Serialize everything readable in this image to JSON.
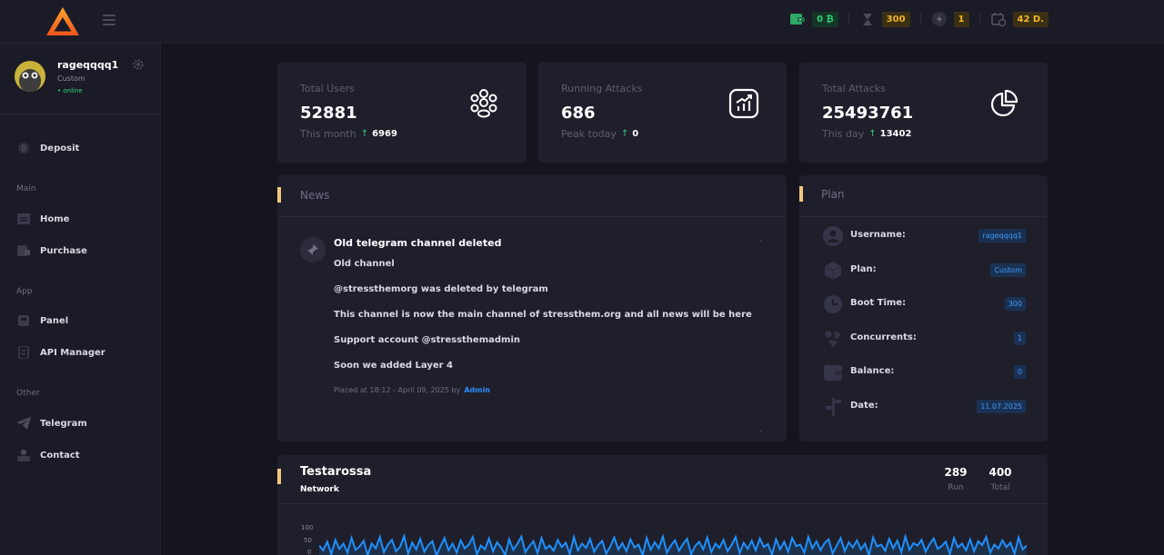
{
  "topbar": {
    "stats": [
      {
        "icon": "wallet-icon",
        "value": "0 ₿",
        "tone": "green"
      },
      {
        "icon": "hourglass-icon",
        "value": "300",
        "tone": "yellow"
      },
      {
        "icon": "lightning-icon",
        "value": "1",
        "tone": "yellow"
      },
      {
        "icon": "calendar-icon",
        "value": "42 D.",
        "tone": "yellow"
      }
    ]
  },
  "sidebar": {
    "profile": {
      "username": "rageqqqq1",
      "plan": "Custom",
      "status": "• online"
    },
    "deposit": "Deposit",
    "sections": [
      {
        "label": "Main",
        "items": [
          "Home",
          "Purchase"
        ]
      },
      {
        "label": "App",
        "items": [
          "Panel",
          "API Manager"
        ]
      },
      {
        "label": "Other",
        "items": [
          "Telegram",
          "Contact"
        ]
      }
    ]
  },
  "stat_cards": [
    {
      "title": "Total Users",
      "value": "52881",
      "sub_label": "This month",
      "sub_value": "6969",
      "icon": "users-icon"
    },
    {
      "title": "Running Attacks",
      "value": "686",
      "sub_label": "Peak today",
      "sub_value": "0",
      "icon": "chart-up-icon"
    },
    {
      "title": "Total Attacks",
      "value": "25493761",
      "sub_label": "This day",
      "sub_value": "13402",
      "icon": "pie-chart-icon"
    }
  ],
  "news": {
    "title": "News",
    "post": {
      "title": "Old telegram channel deleted",
      "lines": [
        "Old channel",
        "@stressthemorg was deleted by telegram",
        "This channel is now the main channel of stressthem.org and all news will be here",
        "Support account @stressthemadmin",
        "Soon we added Layer 4"
      ],
      "meta": "Placed at 18:12 - April 09, 2025 by",
      "author": "Admin"
    }
  },
  "plan": {
    "title": "Plan",
    "rows": [
      {
        "label": "Username:",
        "value": "rageqqqq1",
        "icon": "user-icon"
      },
      {
        "label": "Plan:",
        "value": "Custom",
        "icon": "cube-icon"
      },
      {
        "label": "Boot Time:",
        "value": "300",
        "icon": "clock-icon"
      },
      {
        "label": "Concurrents:",
        "value": "1",
        "icon": "concurrents-icon"
      },
      {
        "label": "Balance:",
        "value": "0",
        "icon": "wallet-icon"
      },
      {
        "label": "Date:",
        "value": "11.07.2025",
        "icon": "signpost-icon"
      }
    ]
  },
  "network": {
    "title": "Testarossa",
    "subtitle": "Network",
    "run_value": "289",
    "run_label": "Run",
    "total_value": "400",
    "total_label": "Total",
    "accent": "#1e90ff"
  },
  "chart_data": {
    "type": "line",
    "title": "Testarossa",
    "ylim": [
      0,
      100
    ],
    "yticks": [
      "100",
      "50",
      "0"
    ],
    "grid": false,
    "series": [
      {
        "values": [
          70,
          60,
          78,
          52,
          82,
          63,
          74,
          55,
          86,
          61,
          68,
          80,
          50,
          74,
          64,
          88,
          56,
          72,
          82,
          58,
          67,
          90,
          53,
          76,
          62,
          84,
          57,
          71,
          79,
          49,
          68,
          86,
          60,
          74,
          55,
          81,
          64,
          72,
          88,
          52,
          70,
          62,
          85,
          58,
          77,
          66,
          50,
          83,
          61,
          73,
          89,
          56,
          69,
          79,
          54,
          86,
          63,
          70,
          59,
          82,
          67,
          76,
          52,
          88,
          60,
          74,
          65,
          84,
          57,
          71,
          80,
          53,
          68,
          87,
          62,
          75,
          58,
          83,
          66,
          72,
          50,
          86,
          61,
          77,
          64,
          89,
          55,
          70,
          81,
          59,
          73,
          84,
          52,
          69,
          78,
          62,
          87,
          56,
          74,
          65,
          82,
          58,
          71,
          88,
          54,
          76,
          63,
          80,
          60,
          85,
          67,
          73,
          51,
          83,
          62,
          78,
          57,
          86,
          69,
          72,
          55,
          88,
          64,
          79,
          60,
          75,
          83,
          53,
          70,
          86,
          58,
          77,
          66,
          81,
          62,
          74,
          50,
          87,
          68,
          72,
          59,
          84,
          64,
          80,
          56,
          89,
          61,
          75,
          70,
          82,
          57,
          73,
          85,
          63,
          69,
          78,
          52,
          86,
          66,
          74,
          60,
          83,
          58,
          79,
          71,
          88,
          55,
          72,
          64,
          81,
          67,
          76,
          53,
          87,
          62,
          70
        ]
      }
    ]
  }
}
